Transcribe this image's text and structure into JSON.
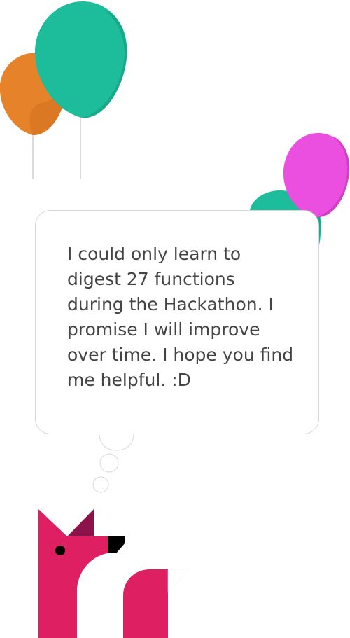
{
  "message": {
    "text": "I could only learn to digest 27 functions during the Hackathon. I promise I will improve over time. I hope you find me helpful. :D",
    "color": "#444444"
  },
  "balloons": [
    {
      "name": "orange-balloon",
      "color": "#e6832a"
    },
    {
      "name": "teal-balloon-large",
      "color": "#1dbc9b"
    },
    {
      "name": "teal-balloon-small",
      "color": "#1dbc9b"
    },
    {
      "name": "pink-balloon",
      "color": "#ea4fdf"
    }
  ],
  "mascot": {
    "icon": "fox-mascot-icon",
    "color": "#de1f62",
    "ear_color": "#8b1349",
    "nose_color": "#000000"
  }
}
